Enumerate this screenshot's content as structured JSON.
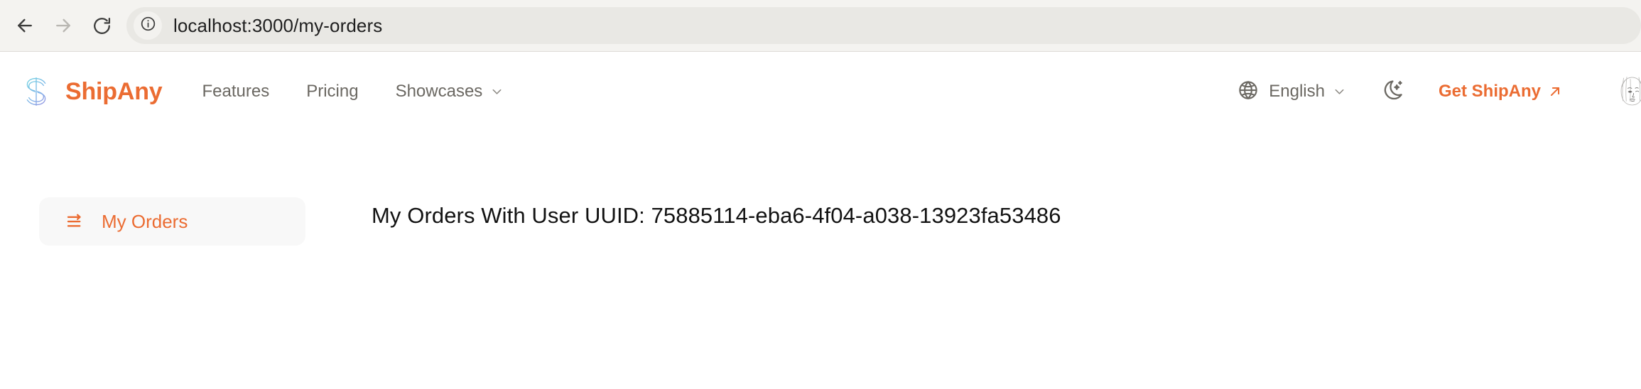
{
  "browser": {
    "back_icon": "arrow-left-icon",
    "forward_icon": "arrow-right-icon",
    "reload_icon": "reload-icon",
    "site_info_icon": "info-circle-icon",
    "url": "localhost:3000/my-orders"
  },
  "header": {
    "brand": {
      "logo_icon": "shipany-s-logo-icon",
      "name": "ShipAny",
      "color": "#eb6c32"
    },
    "nav": [
      {
        "label": "Features",
        "has_chevron": false
      },
      {
        "label": "Pricing",
        "has_chevron": false
      },
      {
        "label": "Showcases",
        "has_chevron": true
      }
    ],
    "language": {
      "icon": "globe-icon",
      "label": "English",
      "chevron_icon": "chevron-down-icon"
    },
    "theme_toggle": {
      "icon": "moon-sparkles-icon"
    },
    "cta": {
      "label": "Get ShipAny",
      "icon": "arrow-up-right-icon",
      "color": "#eb6c32"
    },
    "avatar": {
      "icon": "user-avatar-portrait"
    }
  },
  "sidebar": {
    "items": [
      {
        "label": "My Orders",
        "icon": "list-arrow-icon",
        "active": true
      }
    ]
  },
  "main": {
    "title": "My Orders With User UUID: 75885114-eba6-4f04-a038-13923fa53486"
  }
}
